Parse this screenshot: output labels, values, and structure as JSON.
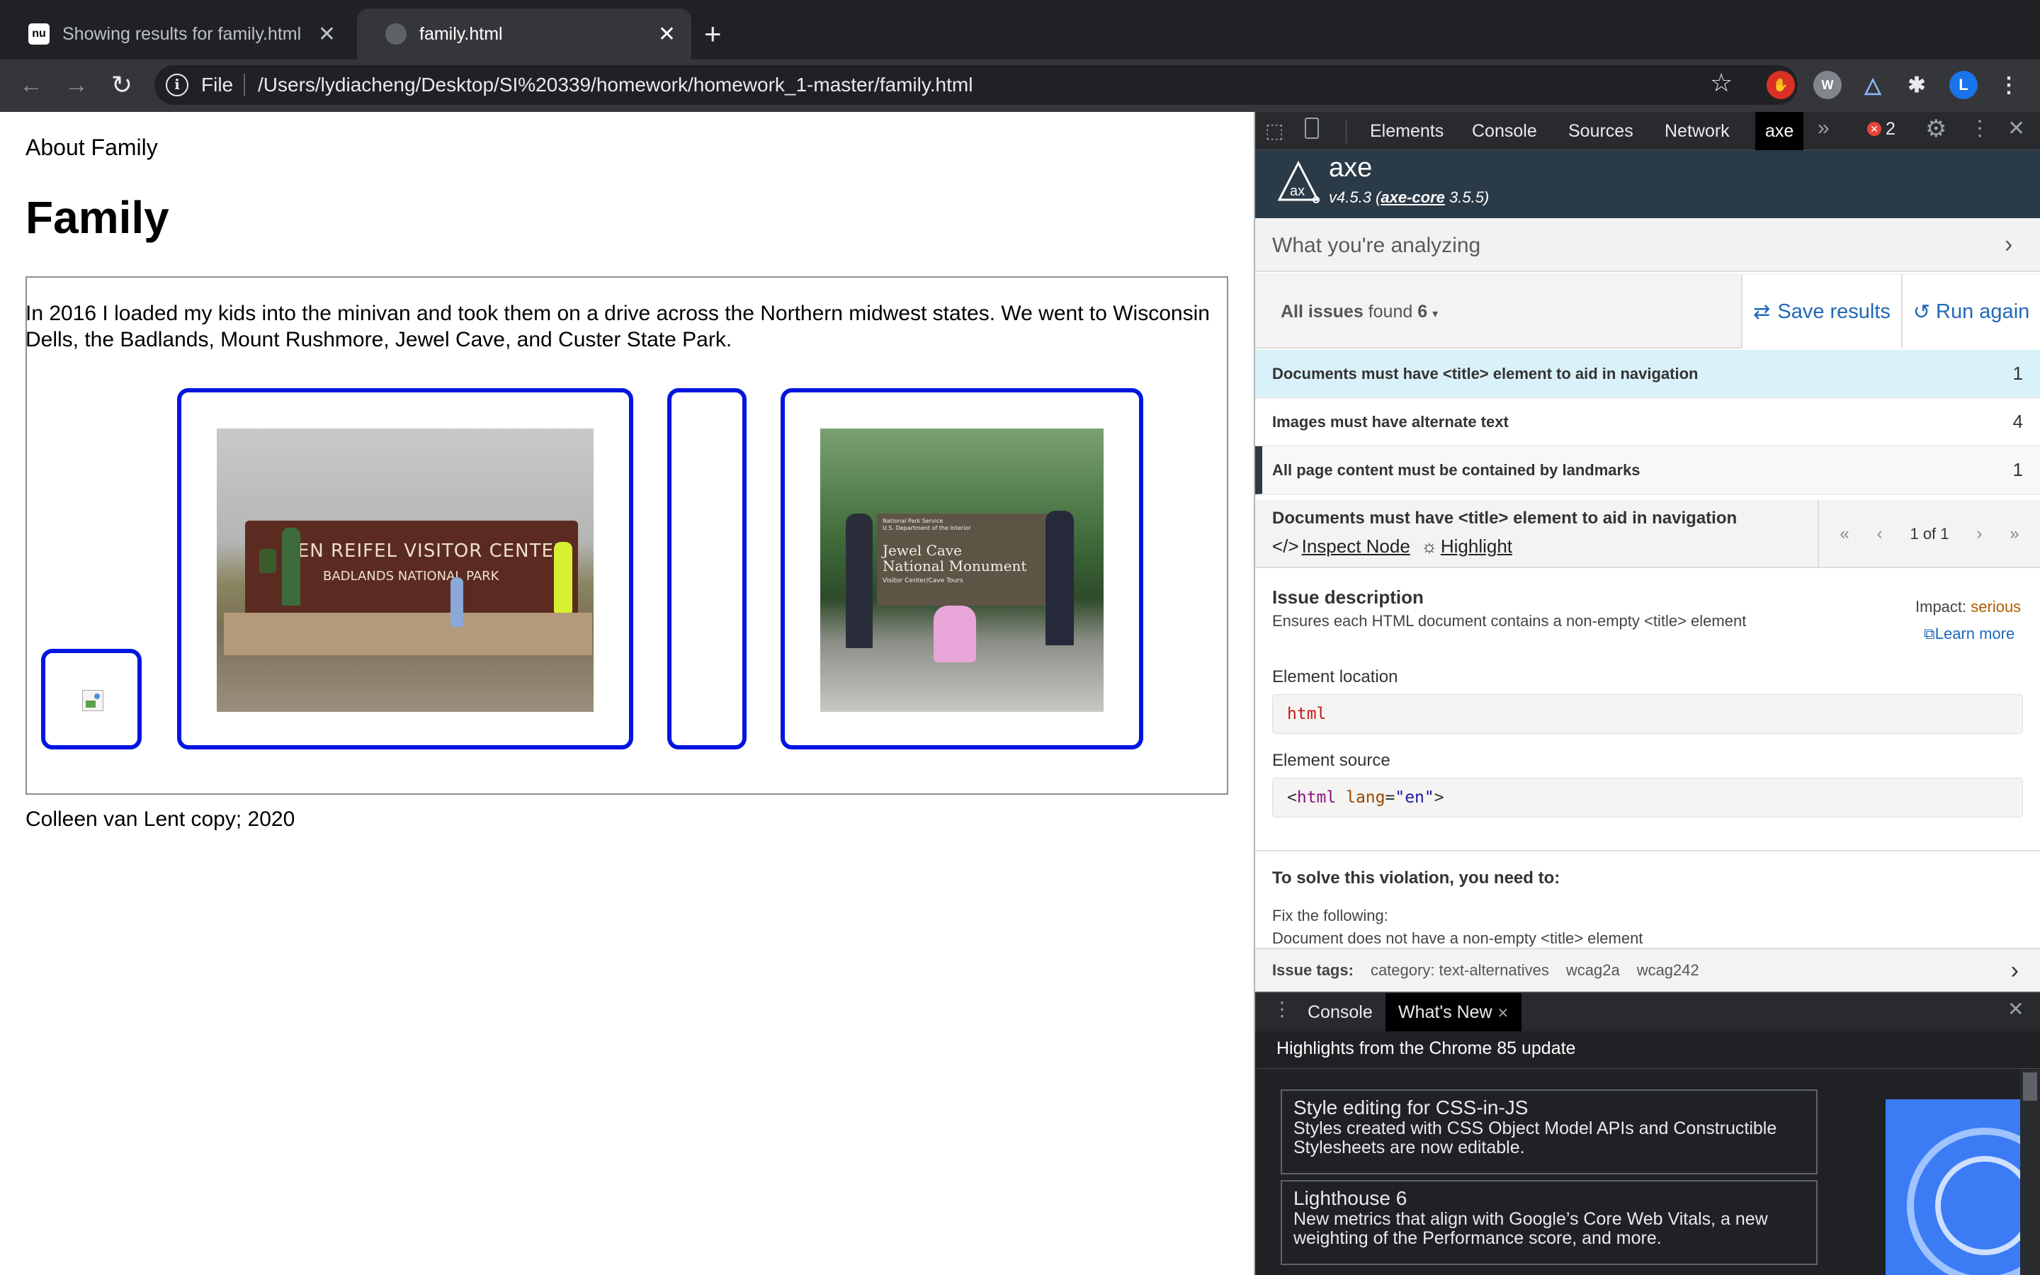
{
  "browser": {
    "tabs": [
      {
        "label": "Showing results for family.html",
        "favicon": "nu"
      },
      {
        "label": "family.html",
        "favicon": "globe"
      }
    ],
    "address": {
      "scheme_label": "File",
      "url": "/Users/lydiacheng/Desktop/SI%20339/homework/homework_1-master/family.html"
    },
    "profile_initial": "L"
  },
  "page": {
    "about": "About Family",
    "heading": "Family",
    "paragraph": "In 2016 I loaded my kids into the minivan and took them on a drive across the Northern midwest states. We went to Wisconsin Dells, the Badlands, Mount Rushmore, Jewel Cave, and Custer State Park.",
    "photo1": {
      "sign_line1": "BEN REIFEL VISITOR CENTER",
      "sign_line2": "BADLANDS NATIONAL PARK"
    },
    "photo2": {
      "sign_small1": "National Park Service",
      "sign_small2": "U.S. Department of the Interior",
      "sign_line1": "Jewel Cave",
      "sign_line2": "National Monument",
      "sign_line3": "Visitor Center/Cave Tours"
    },
    "footer": "Colleen van Lent copy; 2020"
  },
  "devtools": {
    "tabs": [
      "Elements",
      "Console",
      "Sources",
      "Network",
      "axe"
    ],
    "error_count": "2",
    "axe": {
      "name": "axe",
      "version_prefix": "v4.5.3 (",
      "core_link": "axe-core",
      "core_version": " 3.5.5)",
      "analyzing": "What you're analyzing",
      "all_issues": "All issues",
      "found_label": "found",
      "found_count": "6",
      "save_label": "Save results",
      "run_label": "Run again",
      "issues": [
        {
          "title": "Documents must have <title> element to aid in navigation",
          "count": "1"
        },
        {
          "title": "Images must have alternate text",
          "count": "4"
        },
        {
          "title": "All page content must be contained by landmarks",
          "count": "1"
        }
      ],
      "detail": {
        "title": "Documents must have <title> element to aid in navigation",
        "inspect": "Inspect Node",
        "highlight": "Highlight",
        "pager": "1 of 1",
        "desc_heading": "Issue description",
        "desc": "Ensures each HTML document contains a non-empty <title> element",
        "impact_label": "Impact:",
        "impact": "serious",
        "learn_more": "Learn more",
        "location_heading": "Element location",
        "location": "html",
        "source_heading": "Element source",
        "source_open": "<",
        "source_tag": "html",
        "source_attr": " lang",
        "source_eq": "=",
        "source_val": "\"en\"",
        "source_close": ">",
        "solve_heading": "To solve this violation, you need to:",
        "fix_label": "Fix the following:",
        "fix_detail": "Document does not have a non-empty <title> element",
        "tags_label": "Issue tags:",
        "tags": [
          "category: text-alternatives",
          "wcag2a",
          "wcag242"
        ]
      }
    },
    "drawer": {
      "tabs": [
        "Console",
        "What's New"
      ],
      "highlights": "Highlights from the Chrome 85 update",
      "features": [
        {
          "title": "Style editing for CSS-in-JS",
          "desc": "Styles created with CSS Object Model APIs and Constructible Stylesheets are now editable."
        },
        {
          "title": "Lighthouse 6",
          "desc": "New metrics that align with Google’s Core Web Vitals, a new weighting of the Performance score, and more."
        }
      ]
    }
  }
}
